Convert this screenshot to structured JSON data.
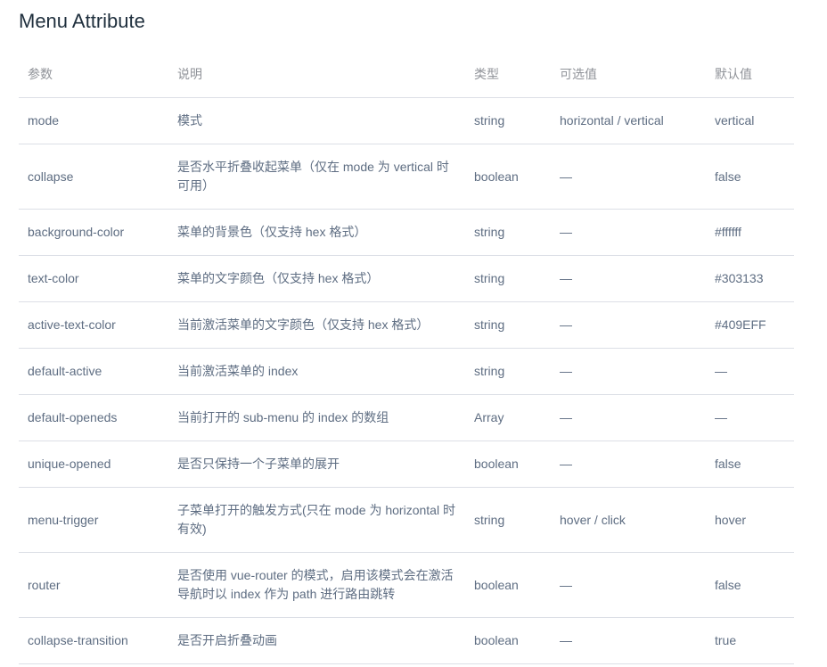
{
  "title": "Menu Attribute",
  "headers": {
    "param": "参数",
    "desc": "说明",
    "type": "类型",
    "options": "可选值",
    "default": "默认值"
  },
  "rows": [
    {
      "param": "mode",
      "desc": "模式",
      "type": "string",
      "options": "horizontal / vertical",
      "default": "vertical"
    },
    {
      "param": "collapse",
      "desc": "是否水平折叠收起菜单（仅在 mode 为 vertical 时可用）",
      "type": "boolean",
      "options": "—",
      "default": "false"
    },
    {
      "param": "background-color",
      "desc": "菜单的背景色（仅支持 hex 格式）",
      "type": "string",
      "options": "—",
      "default": "#ffffff"
    },
    {
      "param": "text-color",
      "desc": "菜单的文字颜色（仅支持 hex 格式）",
      "type": "string",
      "options": "—",
      "default": "#303133"
    },
    {
      "param": "active-text-color",
      "desc": "当前激活菜单的文字颜色（仅支持 hex 格式）",
      "type": "string",
      "options": "—",
      "default": "#409EFF"
    },
    {
      "param": "default-active",
      "desc": "当前激活菜单的 index",
      "type": "string",
      "options": "—",
      "default": "—"
    },
    {
      "param": "default-openeds",
      "desc": "当前打开的 sub-menu 的 index 的数组",
      "type": "Array",
      "options": "—",
      "default": "—"
    },
    {
      "param": "unique-opened",
      "desc": "是否只保持一个子菜单的展开",
      "type": "boolean",
      "options": "—",
      "default": "false"
    },
    {
      "param": "menu-trigger",
      "desc": "子菜单打开的触发方式(只在 mode 为 horizontal 时有效)",
      "type": "string",
      "options": "hover / click",
      "default": "hover"
    },
    {
      "param": "router",
      "desc": "是否使用 vue-router 的模式，启用该模式会在激活导航时以 index 作为 path 进行路由跳转",
      "type": "boolean",
      "options": "—",
      "default": "false"
    },
    {
      "param": "collapse-transition",
      "desc": "是否开启折叠动画",
      "type": "boolean",
      "options": "—",
      "default": "true"
    }
  ]
}
